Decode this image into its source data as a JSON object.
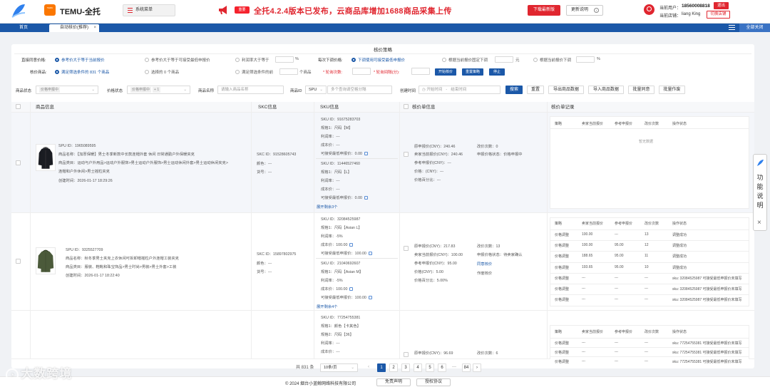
{
  "brand": {
    "logo_name": "sky-logo",
    "temu_badge": "TEMU",
    "title": "TEMU-全托"
  },
  "sys_menu": {
    "label": "系统菜单"
  },
  "announcement": {
    "tag": "重要",
    "text": "全托4.2.4版本已发布，云商品库增加1688商品采集上传",
    "download_label": "下载最新版",
    "update_label": "更新说明",
    "update_icon": "info-icon"
  },
  "user": {
    "current_user_label": "当前用户：",
    "current_user": "18560008818",
    "logout_label": "退出",
    "store_label": "当前店铺：",
    "store_name": "liang King",
    "switch_label": "切换店铺"
  },
  "tabs": {
    "home": "首页",
    "active": "自动核价(推荐)",
    "close_all": "全部关闭"
  },
  "strategy": {
    "title": "核价策略",
    "row1": {
      "label": "直接同意价格:",
      "opt1": "参考价大于等于当前报价",
      "opt2": "参考价大于等于可接受最低申报价",
      "opt3": "利润率大于等于",
      "opt3_unit": "%",
      "label2": "每次下调价格:",
      "opt4": "下调使用可接受最低申报价",
      "opt5": "根据当前报价固定下调",
      "opt5_unit": "元",
      "opt6": "根据当前报价下调",
      "opt6_unit": "%"
    },
    "row2": {
      "label": "核价商品:",
      "opt1": "满足筛选条件的 831 个商品",
      "opt2": "选择的 0 个商品",
      "opt3": "满足筛选条件的前",
      "opt3_unit": "个商品",
      "times_label": "* 轮询次数:",
      "interval_label": "* 轮询间隔(分):",
      "start": "开始核价",
      "reset": "重置策略",
      "stop": "停止"
    }
  },
  "filters": {
    "status_label": "商品状态",
    "status_value": "价格申报中",
    "price_status_label": "价格状态",
    "price_status_value": "价格申报中",
    "price_status_more": "+ 1",
    "name_label": "商品名称",
    "name_placeholder": "请输入商品名称",
    "id_label": "商品ID",
    "id_type": "SPU",
    "id_placeholder": "多个查询请空格分隔",
    "created_label": "创建时间",
    "start_placeholder": "开始时间",
    "end_placeholder": "结束时间",
    "search": "搜索",
    "reset": "重置",
    "export": "导出商品数据",
    "import": "导入商品数据",
    "batch_agree": "批量同意",
    "batch_void": "批量作废"
  },
  "table": {
    "headers": {
      "product": "商品信息",
      "skc": "SKC信息",
      "sku": "SKU信息",
      "pricing": "核价单信息",
      "record": "核价单记录"
    },
    "record_headers": [
      "策略",
      "卖家当前报价",
      "参考申报价",
      "改价次数",
      "操作状态"
    ],
    "rows": [
      {
        "spu": "SPU ID：1965089595",
        "name": "商品名称：【加厚保暖】男士冬季新款中长款连帽外套 休闲 日常通勤户外保暖夹克",
        "category": "商品类目：运动与户外用品>运动户外服饰>男士运动户外服饰>男士运动休闲外套>男士运动休闲夹克>",
        "category2": "连帽和户外休闲>男士摇粒夹克",
        "created": "创建时间：2026-01-17 18:29:26",
        "skc": [
          "SKC ID：91528605743",
          "颜色：---",
          "货号：---"
        ],
        "skus": [
          [
            "SKU ID：91675283703",
            "规格1：尺码【M】",
            "利润率：---",
            "成本价：---",
            "可接受最低申报价：0.00"
          ],
          [
            "SKU ID：11446527460",
            "规格1：尺码【L】",
            "利润率：---",
            "成本价：---",
            "可接受最低申报价：0.00"
          ]
        ],
        "expand": "展开剩余3个",
        "pricing": {
          "declared": "原申报价(CNY)：240.46",
          "current": "卖家当前报价(CNY)：240.46",
          "reference": "参考申报价(CNY)：---",
          "price": "价格：(CNY)：---",
          "pct": "价格百分比：---",
          "changes": "改价次数：0",
          "status": "申报价格状态：价格申报中"
        },
        "records_empty": "暂无数据"
      },
      {
        "spu": "SPU ID：9325527709",
        "name": "商品名称：秋冬季男士夹克上衣休闲可拆卸帽摇粒户外连帽工装夹克",
        "category": "商品类目：服装、鞋靴和珠宝饰品>男士时尚>男装>男士外套>工装",
        "created": "创建时间：2026-01-17 18:22:40",
        "skc": [
          "SKC ID：15897802975",
          "颜色：---",
          "货号：---"
        ],
        "skus": [
          [
            "SKU ID：32084525987",
            "规格1：尺码【Asian L】",
            "利润率：-5%",
            "成本价：100.00",
            "可接受最低申报价：100.00"
          ],
          [
            "SKU ID：21040692607",
            "规格1：尺码【Asian M】",
            "利润率：-5%",
            "成本价：100.00",
            "可接受最低申报价：100.00"
          ]
        ],
        "expand": "展开剩余4个",
        "pricing": {
          "declared": "原申报价(CNY)：217.83",
          "current": "卖家当前报价(CNY)：100.00",
          "reference": "参考申报价(CNY)：95.00",
          "price": "价格(CNY)：5.00",
          "pct": "价格百分比：5.00%",
          "changes": "改价次数：13",
          "status": "申报价格状态：待卖家确认",
          "agree": "同意核价",
          "void": "作废核价"
        },
        "records": [
          [
            "价格调整",
            "100.00",
            "---",
            "13",
            "调整成功"
          ],
          [
            "价格调整",
            "100.00",
            "95.00",
            "12",
            "调整成功"
          ],
          [
            "价格调整",
            "188.65",
            "95.00",
            "11",
            "调整成功"
          ],
          [
            "价格调整",
            "193.65",
            "95.00",
            "10",
            "调整成功"
          ],
          [
            "价格调整",
            "---",
            "---",
            "---",
            "sku: 32084525987 可接受最低申报价未填写"
          ],
          [
            "价格调整",
            "---",
            "---",
            "---",
            "sku: 32084525987 可接受最低申报价未填写"
          ],
          [
            "价格调整",
            "---",
            "---",
            "---",
            "sku: 32084525987 可接受最低申报价未填写"
          ]
        ]
      },
      {
        "skus": [
          [
            "SKU ID：77254755381",
            "规格1：颜色【卡其色】",
            "规格2：尺码【36】",
            "利润率：---",
            "成本价：---",
            "可接受最低申报价：0.00"
          ]
        ],
        "pricing": {
          "declared": "原申报价(CNY)：96.69",
          "changes": "改价次数：6"
        },
        "records": [
          [
            "价格调整",
            "---",
            "---",
            "---",
            "sku: 77254755381 可接受最低申报价未填写"
          ],
          [
            "价格调整",
            "---",
            "---",
            "---",
            "sku: 77254755381 可接受最低申报价未填写"
          ],
          [
            "价格调整",
            "---",
            "---",
            "---",
            "sku: 77254755381 可接受最低申报价未填写"
          ]
        ]
      }
    ]
  },
  "pagination": {
    "total": "共 831 条",
    "page_size": "10条/页",
    "pages": [
      "1",
      "2",
      "3",
      "4",
      "5",
      "6",
      "···",
      "84"
    ],
    "current": "1"
  },
  "footer": {
    "copyright": "© 2024 烟台小蓝鲸网络科技有限公司",
    "disclaimer": "免责声明",
    "license": "授权协议"
  },
  "float_panel": {
    "label": "功能说明",
    "icon": "sky-logo",
    "close_icon": "close-icon"
  },
  "watermark": "大数跨境"
}
